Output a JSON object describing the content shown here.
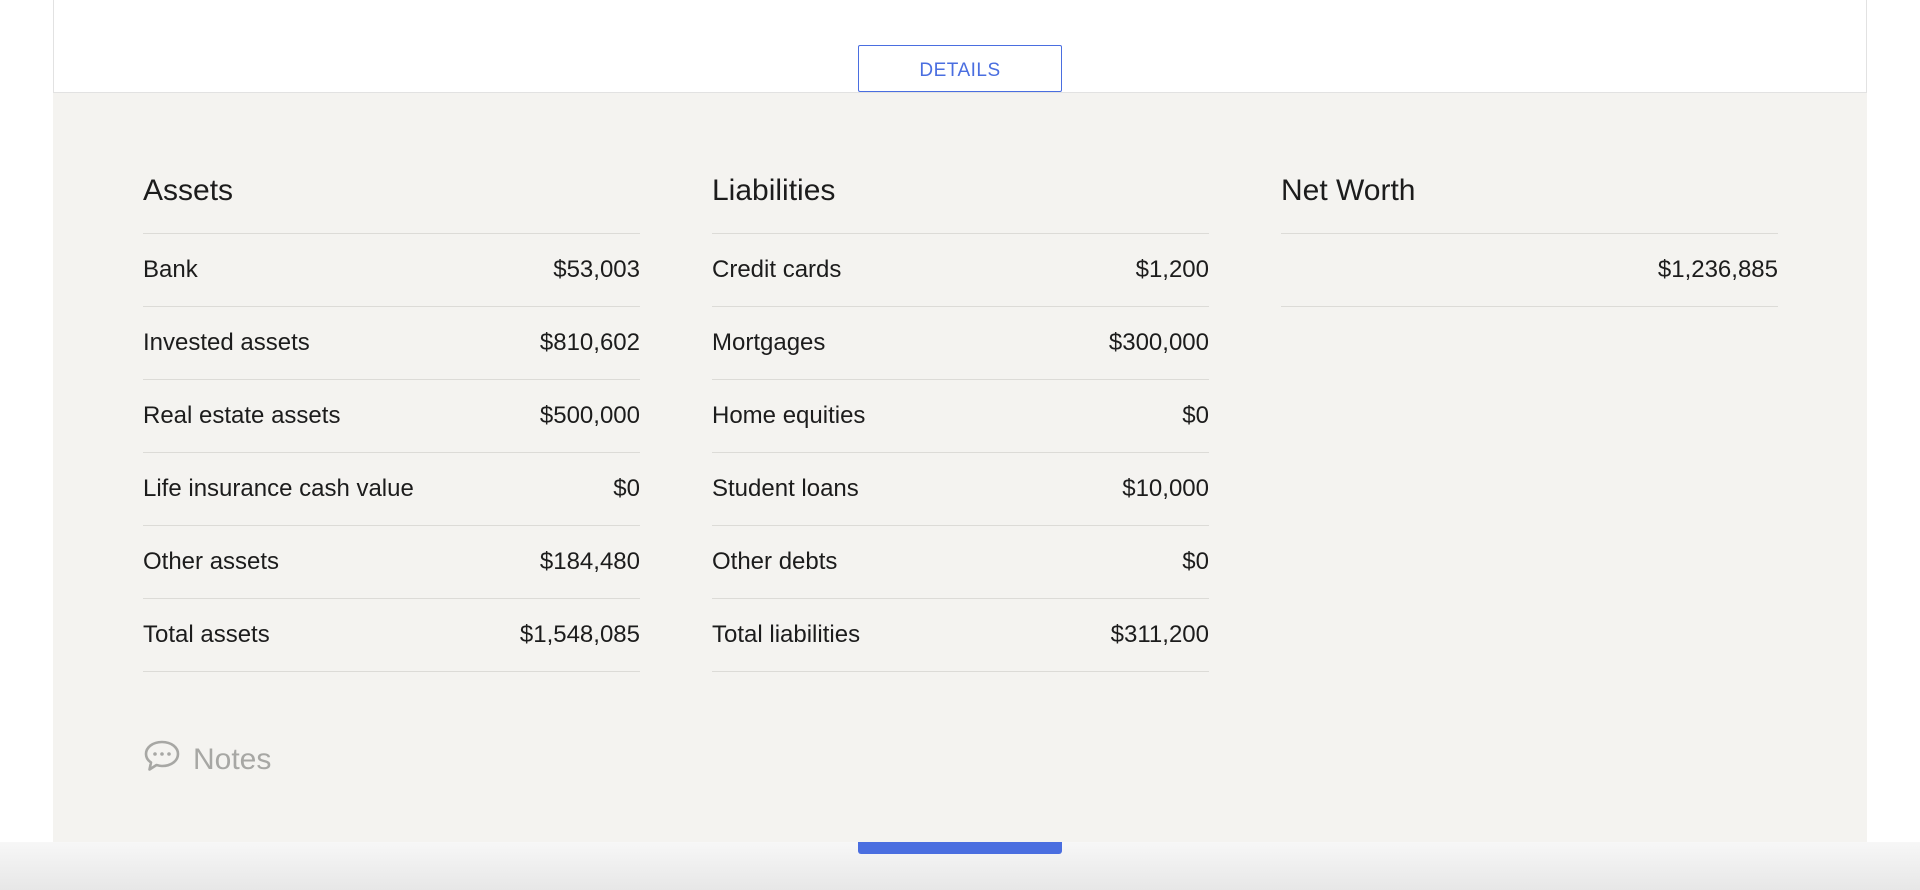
{
  "details_button": {
    "label": "DETAILS"
  },
  "assets": {
    "title": "Assets",
    "rows": [
      {
        "label": "Bank",
        "value": "$53,003"
      },
      {
        "label": "Invested assets",
        "value": "$810,602"
      },
      {
        "label": "Real estate assets",
        "value": "$500,000"
      },
      {
        "label": "Life insurance cash value",
        "value": "$0"
      },
      {
        "label": "Other assets",
        "value": "$184,480"
      },
      {
        "label": "Total assets",
        "value": "$1,548,085"
      }
    ]
  },
  "liabilities": {
    "title": "Liabilities",
    "rows": [
      {
        "label": "Credit cards",
        "value": "$1,200"
      },
      {
        "label": "Mortgages",
        "value": "$300,000"
      },
      {
        "label": "Home equities",
        "value": "$0"
      },
      {
        "label": "Student loans",
        "value": "$10,000"
      },
      {
        "label": "Other debts",
        "value": "$0"
      },
      {
        "label": "Total liabilities",
        "value": "$311,200"
      }
    ]
  },
  "net_worth": {
    "title": "Net Worth",
    "value": "$1,236,885"
  },
  "notes": {
    "label": "Notes",
    "icon": "speech-bubble-icon"
  },
  "colors": {
    "accent": "#4a6ee0",
    "panel_background": "#f4f3f0",
    "muted_text": "#a7a7a4"
  }
}
